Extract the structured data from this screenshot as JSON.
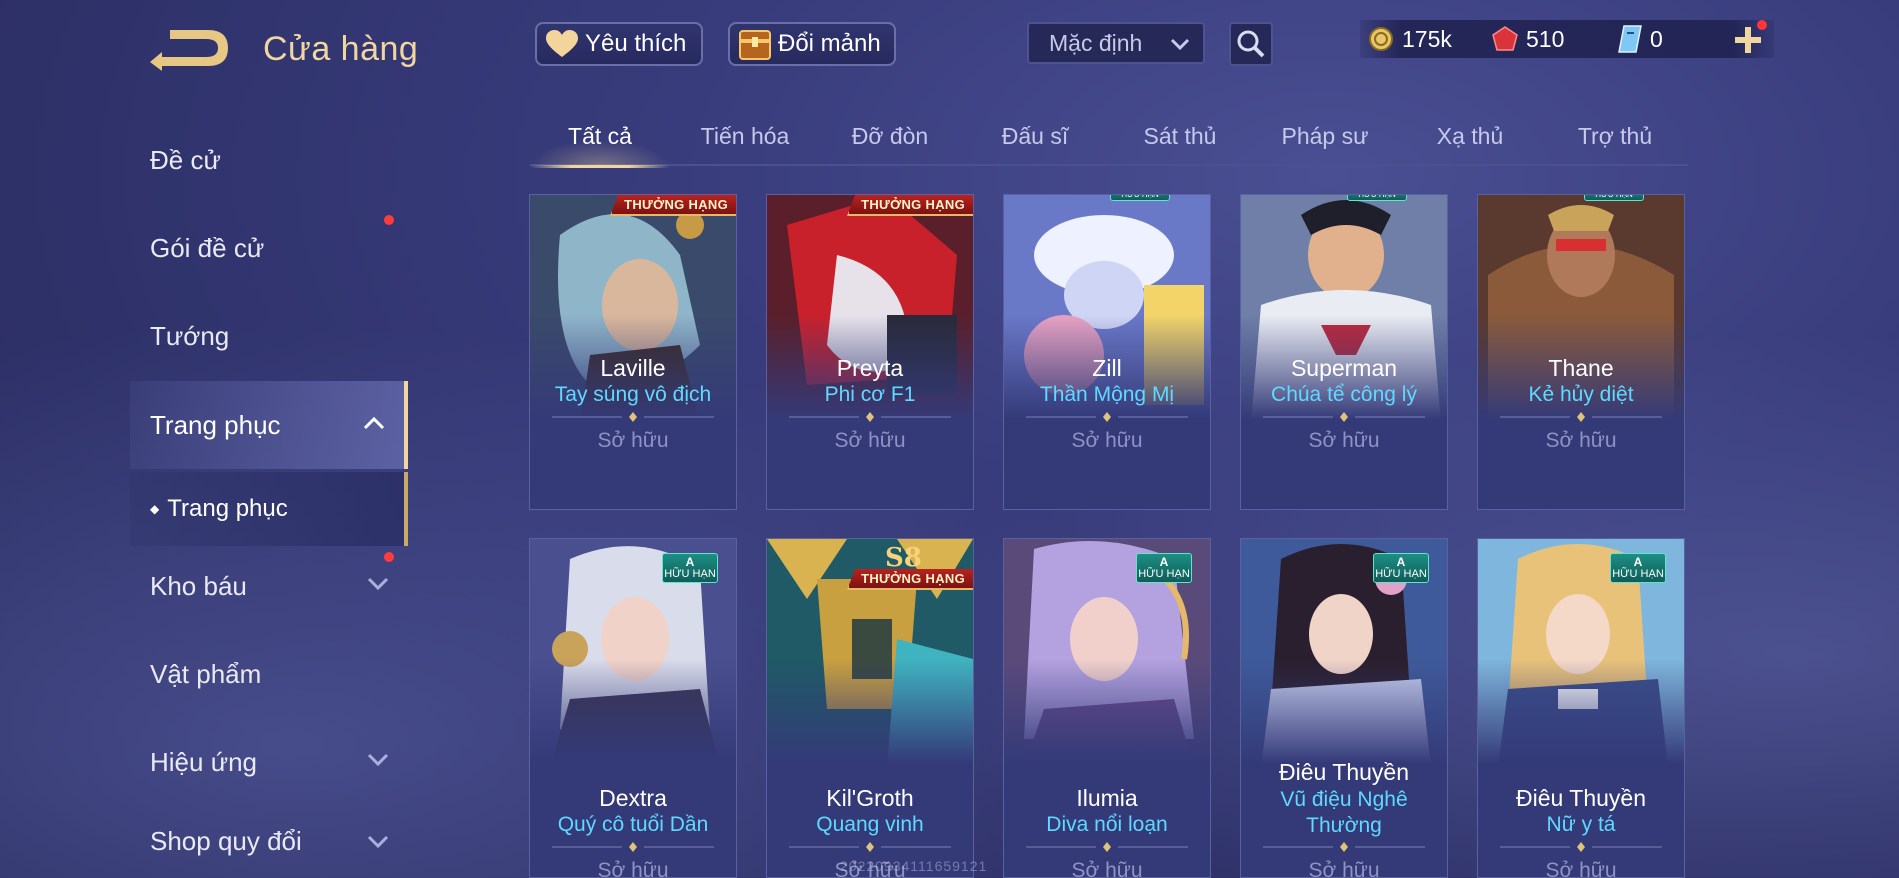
{
  "header": {
    "title": "Cửa hàng",
    "favorites_label": "Yêu thích",
    "fragments_label": "Đổi mảnh",
    "sort_value": "Mặc định"
  },
  "currency": {
    "gold": "175k",
    "ruby": "510",
    "voucher": "0"
  },
  "sidebar": {
    "items": [
      {
        "label": "Đề cử"
      },
      {
        "label": "Gói đề cử"
      },
      {
        "label": "Tướng"
      },
      {
        "label": "Trang phục"
      },
      {
        "label": "Kho báu"
      },
      {
        "label": "Vật phẩm"
      },
      {
        "label": "Hiệu ứng"
      },
      {
        "label": "Shop quy đổi"
      }
    ],
    "sub_item": "Trang phục"
  },
  "tabs": [
    "Tất cả",
    "Tiến hóa",
    "Đỡ đòn",
    "Đấu sĩ",
    "Sát thủ",
    "Pháp sư",
    "Xạ thủ",
    "Trợ thủ"
  ],
  "badges": {
    "ranked": "THƯỞNG HẠNG",
    "limited_grade": "A",
    "limited": "HỮU HẠN",
    "season": "S8"
  },
  "cards": [
    {
      "hero": "Laville",
      "skin": "Tay súng vô địch",
      "status": "Sở hữu"
    },
    {
      "hero": "Preyta",
      "skin": "Phi cơ F1",
      "status": "Sở hữu"
    },
    {
      "hero": "Zill",
      "skin": "Thần Mộng Mị",
      "status": "Sở hữu"
    },
    {
      "hero": "Superman",
      "skin": "Chúa tể công lý",
      "status": "Sở hữu"
    },
    {
      "hero": "Thane",
      "skin": "Kẻ hủy diệt",
      "status": "Sở hữu"
    },
    {
      "hero": "Dextra",
      "skin": "Quý cô tuổi Dần",
      "status": "Sở hữu"
    },
    {
      "hero": "Kil'Groth",
      "skin": "Quang vinh",
      "status": "Sở hữu"
    },
    {
      "hero": "Ilumia",
      "skin": "Diva nổi loạn",
      "status": "Sở hữu"
    },
    {
      "hero": "Điêu Thuyền",
      "skin": "Vũ điệu Nghê Thường",
      "status": "Sở hữu"
    },
    {
      "hero": "Điêu Thuyền",
      "skin": "Nữ y tá",
      "status": "Sở hữu"
    }
  ],
  "watermark": "20220934111659121",
  "colors": {
    "accent_gold": "#f1d79f",
    "skin_name": "#5fd9ff",
    "owned_text": "#8e93c4",
    "background": "#383c7c",
    "notification": "#ff3b3b"
  },
  "icons": {
    "back": "back-arrow-icon",
    "favorite": "heart-icon",
    "fragments": "chest-icon",
    "sort": "chevron-down-icon",
    "search": "search-icon",
    "gold": "gold-coin-icon",
    "ruby": "ruby-icon",
    "voucher": "voucher-icon",
    "add": "plus-icon"
  }
}
